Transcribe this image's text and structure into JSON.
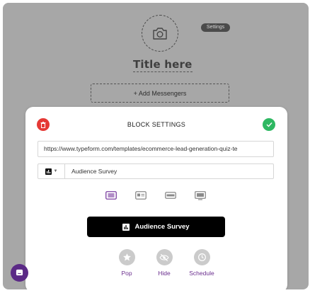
{
  "header": {
    "avatar_icon": "camera-icon",
    "settings_label": "Settings",
    "title": "Title here",
    "add_messengers_label": "+ Add Messengers"
  },
  "modal": {
    "title": "BLOCK SETTINGS",
    "delete_icon": "trash-icon",
    "confirm_icon": "check-icon",
    "url_value": "https://www.typeform.com/templates/ecommerce-lead-generation-quiz-te",
    "block_icon": "chart-icon",
    "block_name": "Audience Survey",
    "layouts": [
      "layout-text-lines",
      "layout-card",
      "layout-bar",
      "layout-screen"
    ],
    "selected_layout": 0,
    "preview_label": "Audience Survey",
    "actions": [
      {
        "label": "Pop",
        "icon": "star-icon"
      },
      {
        "label": "Hide",
        "icon": "eye-slash-icon"
      },
      {
        "label": "Schedule",
        "icon": "clock-icon"
      }
    ]
  },
  "colors": {
    "delete": "#e53935",
    "confirm": "#2eb862",
    "accent": "#6b2f8f",
    "chat": "#5b2a86"
  },
  "chat_icon": "chat-bubble-icon"
}
